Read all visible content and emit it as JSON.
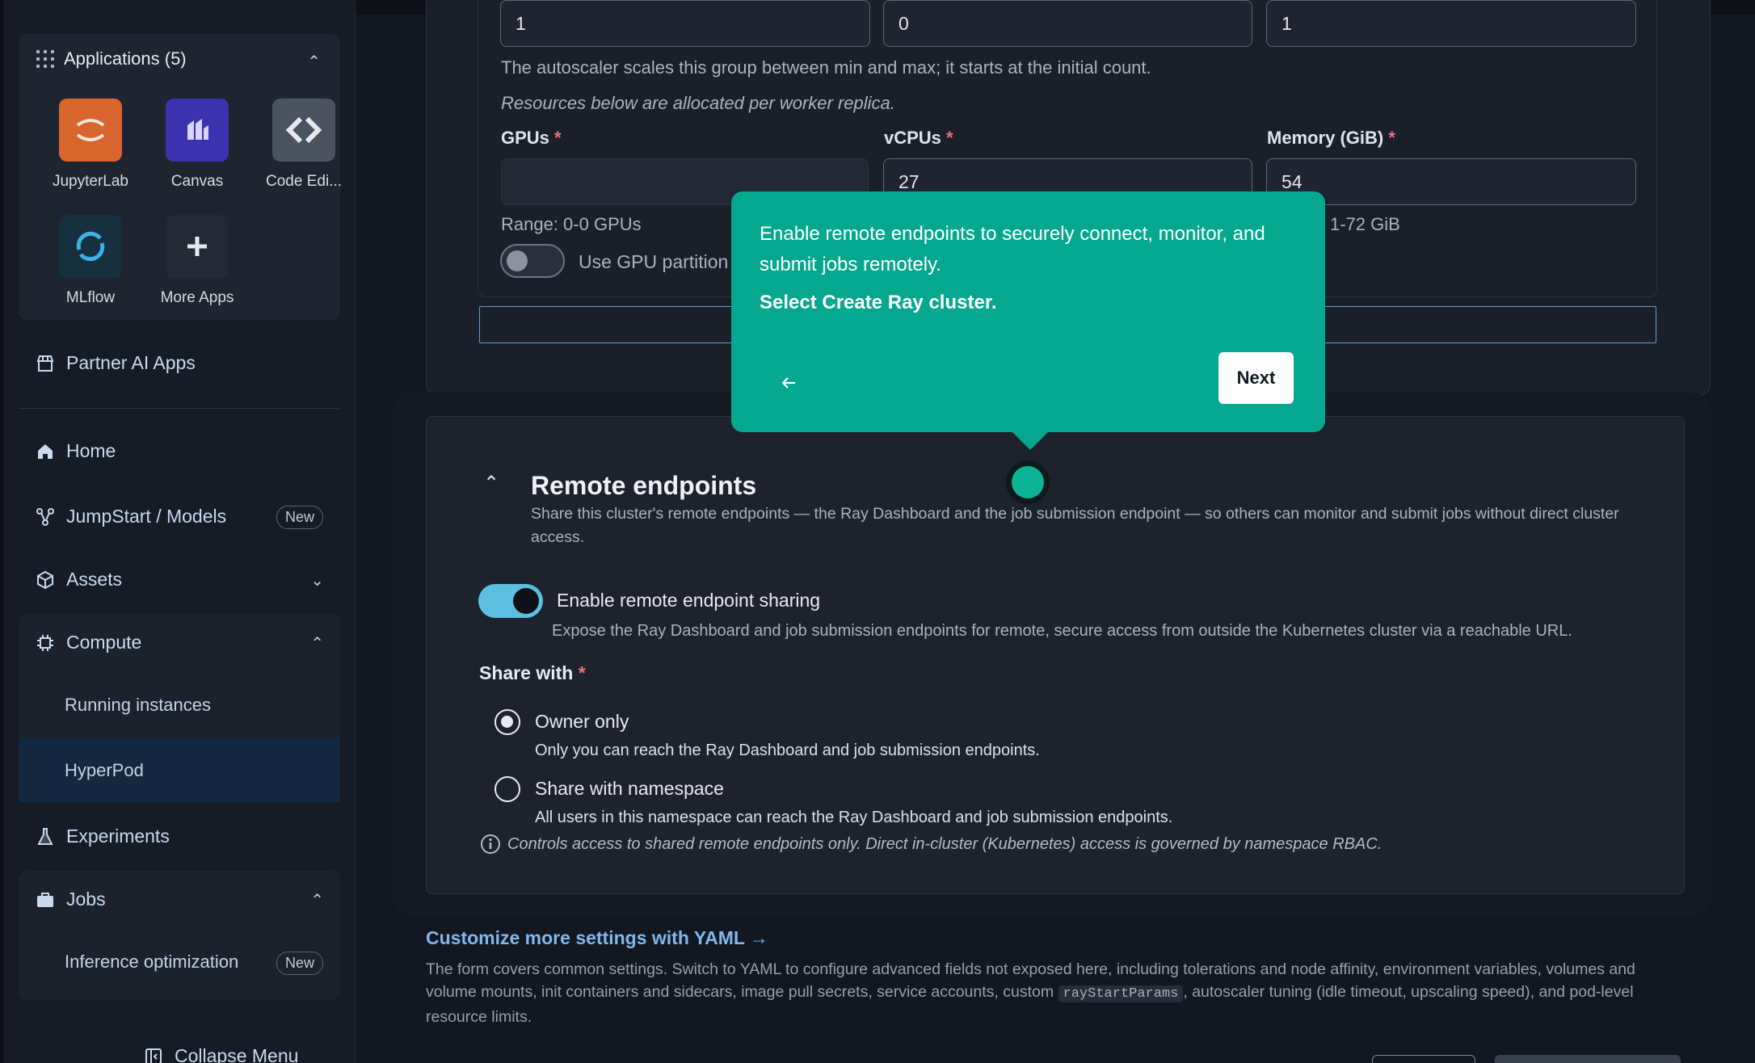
{
  "sidebar": {
    "applications_label": "Applications (5)",
    "apps": [
      {
        "label": "JupyterLab",
        "icon": "jupyterlab-icon",
        "color": "#d8652e"
      },
      {
        "label": "Canvas",
        "icon": "canvas-icon",
        "color": "#3c32b0"
      },
      {
        "label": "Code Edi...",
        "icon": "code-editor-icon",
        "color": "#4b5260"
      },
      {
        "label": "MLflow",
        "icon": "mlflow-icon",
        "color": "#17303f"
      },
      {
        "label": "More Apps",
        "icon": "plus-icon",
        "color": "#232a36"
      }
    ],
    "partner": "Partner AI Apps",
    "home": "Home",
    "jumpstart": "JumpStart / Models",
    "new_badge": "New",
    "assets": "Assets",
    "compute": "Compute",
    "running_instances": "Running instances",
    "hyperpod": "HyperPod",
    "experiments": "Experiments",
    "jobs": "Jobs",
    "inference_optimization": "Inference optimization",
    "collapse": "Collapse Menu"
  },
  "worker_group": {
    "min_value": "1",
    "initial_value": "0",
    "max_value": "1",
    "autoscaler_hint": "The autoscaler scales this group between min and max; it starts at the initial count.",
    "resources_hint": "Resources below are allocated per worker replica.",
    "gpus_label": "GPUs",
    "vcpus_label": "vCPUs",
    "memory_label": "Memory (GiB)",
    "required_mark": "*",
    "gpus_value": "",
    "vcpus_value": "27",
    "memory_value": "54",
    "gpu_range": "Range: 0-0 GPUs",
    "memory_range": "1-72 GiB",
    "gpu_partition_label": "Use GPU partition"
  },
  "remote": {
    "title": "Remote endpoints",
    "description": "Share this cluster's remote endpoints — the Ray Dashboard and the job submission endpoint — so others can monitor and submit jobs without direct cluster access.",
    "toggle_label": "Enable remote endpoint sharing",
    "toggle_desc": "Expose the Ray Dashboard and job submission endpoints for remote, secure access from outside the Kubernetes cluster via a reachable URL.",
    "share_with_label": "Share with",
    "owner_only": "Owner only",
    "owner_only_desc": "Only you can reach the Ray Dashboard and job submission endpoints.",
    "share_namespace": "Share with namespace",
    "share_namespace_desc": "All users in this namespace can reach the Ray Dashboard and job submission endpoints.",
    "info_note": "Controls access to shared remote endpoints only. Direct in-cluster (Kubernetes) access is governed by namespace RBAC.",
    "sharing_enabled": true,
    "selected_option": "Owner only"
  },
  "yaml": {
    "link": "Customize more settings with YAML →",
    "desc_before": "The form covers common settings. Switch to YAML to configure advanced fields not exposed here, including tolerations and node affinity, environment variables, volumes and volume mounts, init containers and sidecars, image pull secrets, service accounts, custom",
    "code": "rayStartParams",
    "desc_after": ", autoscaler tuning (idle timeout, upscaling speed), and pod-level resource limits."
  },
  "tooltip": {
    "body": "Enable remote endpoints to securely connect, monitor, and submit jobs remotely.",
    "action": "Select Create Ray cluster.",
    "next": "Next"
  },
  "colors": {
    "tooltip_bg": "#05a88f",
    "toggle_on": "#5cbfe0",
    "link": "#7fb9ea",
    "required": "#e87470"
  }
}
